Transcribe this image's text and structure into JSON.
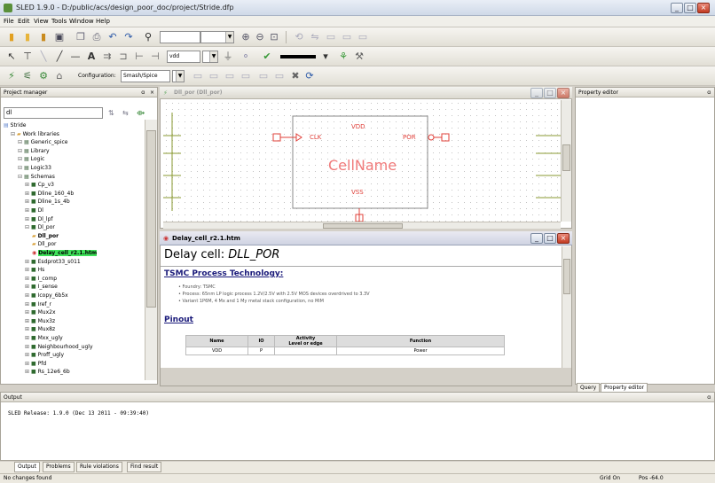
{
  "window": {
    "title": "SLED 1.9.0 - D:/public/acs/design_poor_doc/project/Stride.dfp"
  },
  "menu": [
    "File",
    "Edit",
    "View",
    "Tools",
    "Window",
    "Help"
  ],
  "toolbar": {
    "net_combo": "",
    "vdd_combo": "vdd",
    "configuration_label": "Configuration:",
    "configuration_value": "Smash/Spice"
  },
  "project_manager": {
    "title": "Project manager",
    "search_value": "dl",
    "tree": [
      {
        "label": "Stride",
        "indent": 0,
        "kind": "project"
      },
      {
        "label": "Work libraries",
        "indent": 1,
        "kind": "folder"
      },
      {
        "label": "Generic_spice",
        "indent": 2,
        "kind": "lib"
      },
      {
        "label": "Library",
        "indent": 2,
        "kind": "lib"
      },
      {
        "label": "Logic",
        "indent": 2,
        "kind": "lib"
      },
      {
        "label": "Logic33",
        "indent": 2,
        "kind": "lib"
      },
      {
        "label": "Schemas",
        "indent": 2,
        "kind": "lib"
      },
      {
        "label": "Cp_v3",
        "indent": 3,
        "kind": "cell"
      },
      {
        "label": "Dline_160_4b",
        "indent": 3,
        "kind": "cell"
      },
      {
        "label": "Dline_1s_4b",
        "indent": 3,
        "kind": "cell"
      },
      {
        "label": "Dl",
        "indent": 3,
        "kind": "cell"
      },
      {
        "label": "Dl_lpf",
        "indent": 3,
        "kind": "cell"
      },
      {
        "label": "Dl_por",
        "indent": 3,
        "kind": "cell"
      },
      {
        "label": "Dll_por",
        "indent": 4,
        "kind": "view",
        "bold": true
      },
      {
        "label": "Dll_por",
        "indent": 4,
        "kind": "view"
      },
      {
        "label": "Delay_cell_r2.1.htm",
        "indent": 4,
        "kind": "doc",
        "selected": true
      },
      {
        "label": "Esdprot33_s011",
        "indent": 3,
        "kind": "cell"
      },
      {
        "label": "Hs",
        "indent": 3,
        "kind": "cell"
      },
      {
        "label": "I_comp",
        "indent": 3,
        "kind": "cell"
      },
      {
        "label": "I_sense",
        "indent": 3,
        "kind": "cell"
      },
      {
        "label": "Icopy_6b5x",
        "indent": 3,
        "kind": "cell"
      },
      {
        "label": "Iref_r",
        "indent": 3,
        "kind": "cell"
      },
      {
        "label": "Mux2x",
        "indent": 3,
        "kind": "cell"
      },
      {
        "label": "Mux3z",
        "indent": 3,
        "kind": "cell"
      },
      {
        "label": "Mux8z",
        "indent": 3,
        "kind": "cell"
      },
      {
        "label": "Mxx_ugly",
        "indent": 3,
        "kind": "cell"
      },
      {
        "label": "Neighbourhood_ugly",
        "indent": 3,
        "kind": "cell"
      },
      {
        "label": "Proff_ugly",
        "indent": 3,
        "kind": "cell"
      },
      {
        "label": "Pfd",
        "indent": 3,
        "kind": "cell"
      },
      {
        "label": "Rs_12e6_6b",
        "indent": 3,
        "kind": "cell"
      }
    ]
  },
  "schematic": {
    "title": "Dll_por (Dll_por)",
    "pins": {
      "clk": "CLK",
      "por": "POR",
      "vdd": "VDD",
      "vss": "VSS"
    },
    "cell_name": "CellName"
  },
  "document": {
    "title": "Delay_cell_r2.1.htm",
    "heading_prefix": "Delay cell: ",
    "heading_name": "DLL_POR",
    "section1": "TSMC Process Technology:",
    "bullets": [
      "Foundry: TSMC",
      "Process: 65nm LP logic process 1.2V/2.5V with 2.5V MOS devices overdrived to 3.3V",
      "Variant 1P6M, 4 Mx and 1 My metal stack configuration, no MiM"
    ],
    "section2": "Pinout",
    "table_headers": [
      "Name",
      "IO",
      "Activity\nLevel or edge",
      "Function"
    ],
    "table_rows": [
      [
        "VDD",
        "P",
        "",
        "Power"
      ]
    ]
  },
  "property_editor": {
    "title": "Property editor",
    "tabs": [
      "Query",
      "Property editor"
    ]
  },
  "output": {
    "title": "Output",
    "text": "SLED Release: 1.9.0 (Dec 13 2011 - 09:39:40)",
    "tabs": [
      "Output",
      "Problems",
      "Rule violations",
      "Find result"
    ]
  },
  "status": {
    "left": "No changes found",
    "grid": "Grid On",
    "pos": "Pos -64.0"
  },
  "colors": {
    "schematic_red": "#e0403a",
    "selection_green": "#3fe35a",
    "doc_heading": "#1a1a7a"
  }
}
